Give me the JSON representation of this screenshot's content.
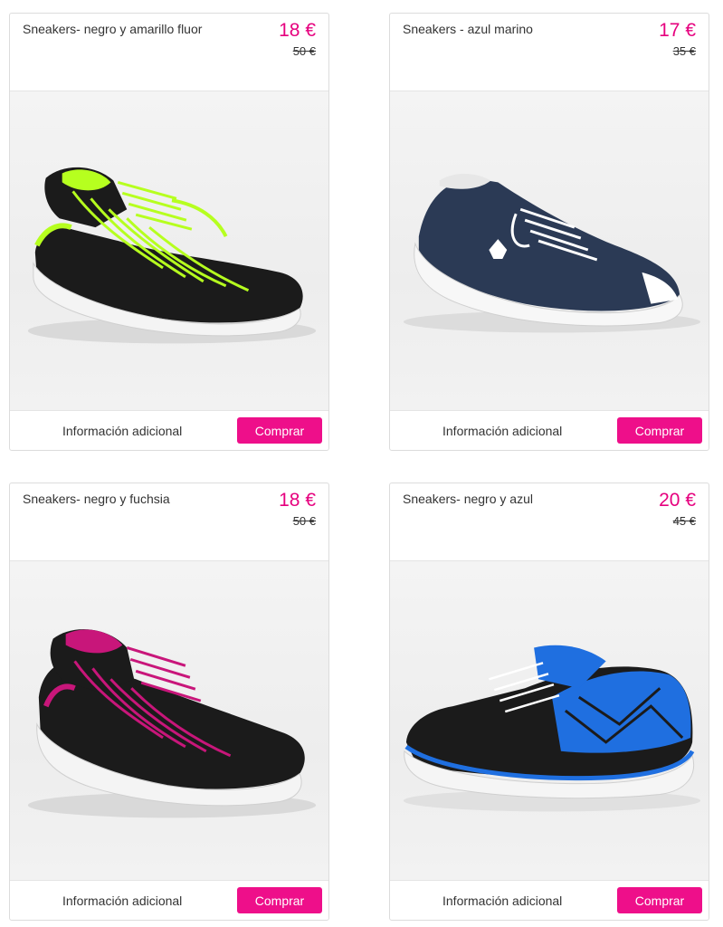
{
  "products": [
    {
      "title": "Sneakers- negro y amarillo fluor",
      "price": "18 €",
      "old_price": "50 €",
      "info_label": "Información adicional",
      "buy_label": "Comprar",
      "image": "black-neon-yellow-sneaker"
    },
    {
      "title": "Sneakers - azul marino",
      "price": "17 €",
      "old_price": "35 €",
      "info_label": "Información adicional",
      "buy_label": "Comprar",
      "image": "navy-canvas-sneaker"
    },
    {
      "title": "Sneakers- negro y fuchsia",
      "price": "18 €",
      "old_price": "50 €",
      "info_label": "Información adicional",
      "buy_label": "Comprar",
      "image": "black-fuchsia-sneaker"
    },
    {
      "title": "Sneakers- negro y azul",
      "price": "20 €",
      "old_price": "45 €",
      "info_label": "Información adicional",
      "buy_label": "Comprar",
      "image": "black-blue-sneaker"
    }
  ],
  "colors": {
    "accent": "#e6007e",
    "button": "#ee0f8a",
    "border": "#dcdcdc",
    "neon_yellow": "#b6ff1f",
    "navy": "#2b3a55",
    "fuchsia": "#c8167a",
    "blue": "#1f6fe0"
  }
}
